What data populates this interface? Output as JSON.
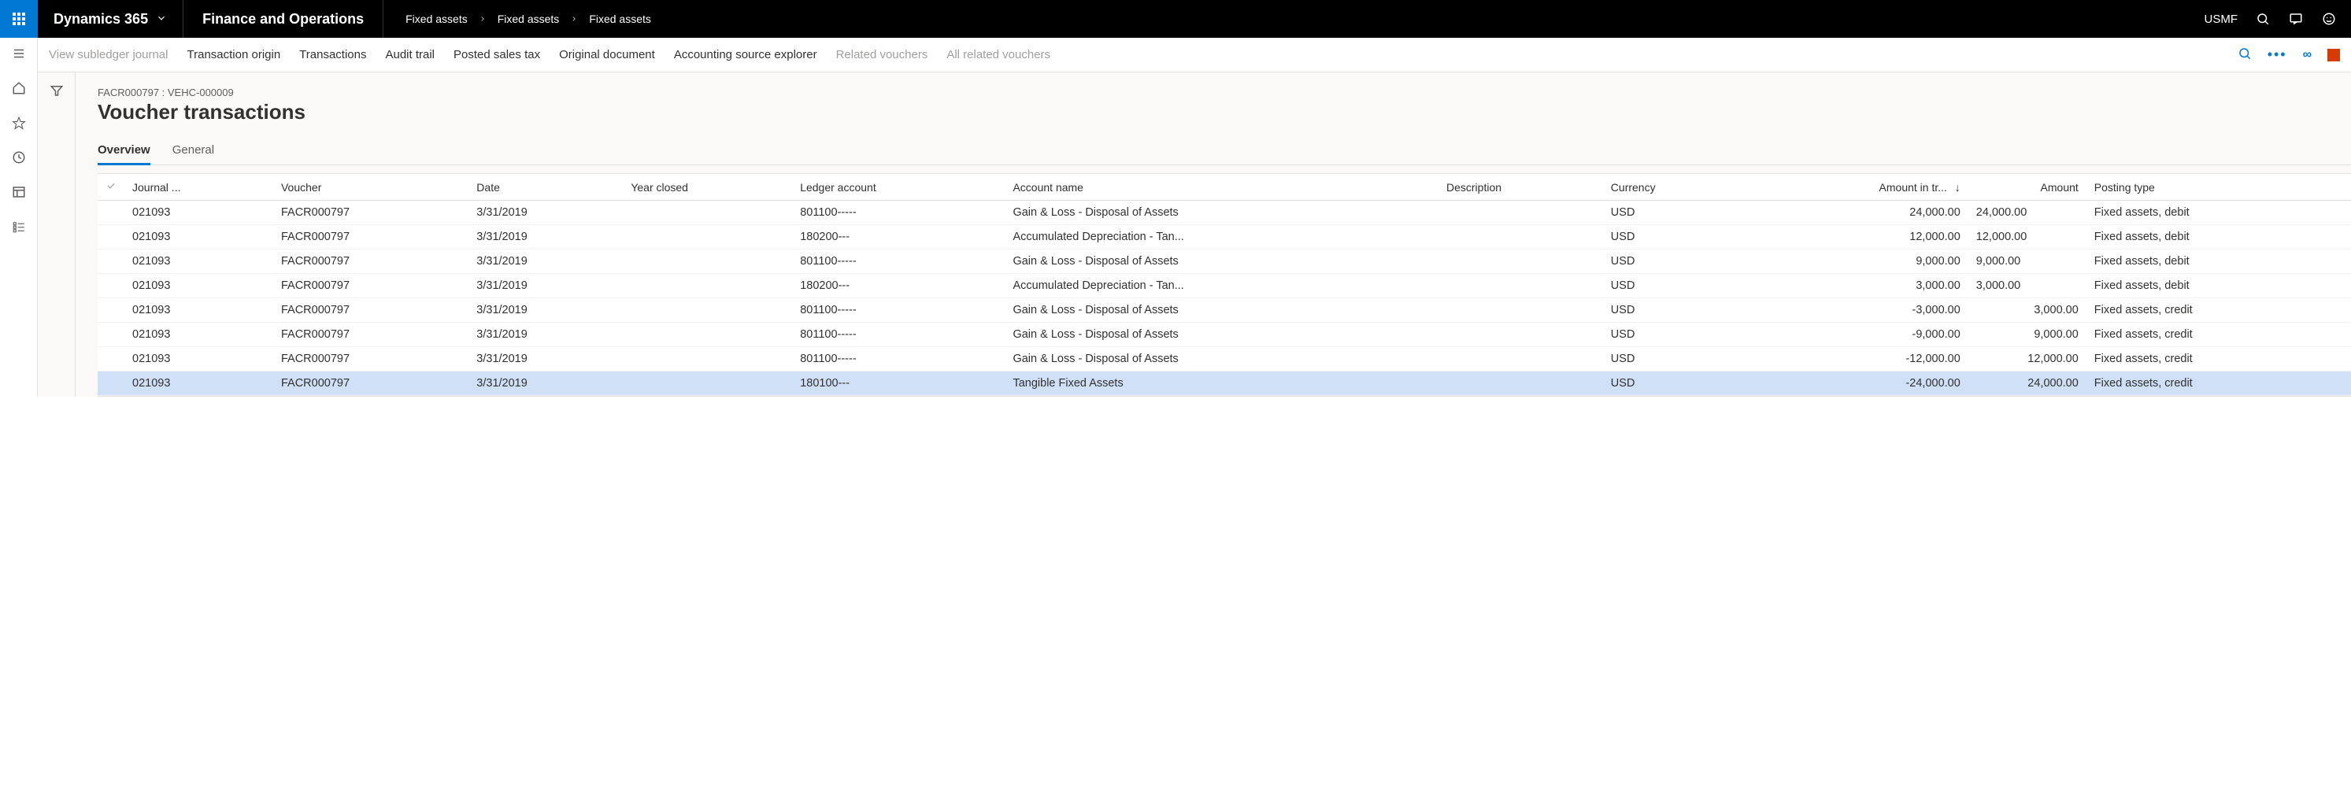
{
  "header": {
    "brand": "Dynamics 365",
    "module": "Finance and Operations",
    "breadcrumbs": [
      "Fixed assets",
      "Fixed assets",
      "Fixed assets"
    ],
    "company": "USMF"
  },
  "actions": {
    "view_subledger": "View subledger journal",
    "transaction_origin": "Transaction origin",
    "transactions": "Transactions",
    "audit_trail": "Audit trail",
    "posted_sales_tax": "Posted sales tax",
    "original_document": "Original document",
    "accounting_source_explorer": "Accounting source explorer",
    "related_vouchers": "Related vouchers",
    "all_related_vouchers": "All related vouchers"
  },
  "page": {
    "context": "FACR000797 : VEHC-000009",
    "title": "Voucher transactions",
    "tabs": {
      "overview": "Overview",
      "general": "General"
    }
  },
  "columns": {
    "journal": "Journal ...",
    "voucher": "Voucher",
    "date": "Date",
    "year_closed": "Year closed",
    "ledger_account": "Ledger account",
    "account_name": "Account name",
    "description": "Description",
    "currency": "Currency",
    "amount_in_trans": "Amount in tr...",
    "amount": "Amount",
    "posting_type": "Posting type"
  },
  "sort_indicator": "↓",
  "rows": [
    {
      "journal": "021093",
      "voucher": "FACR000797",
      "date": "3/31/2019",
      "year_closed": "",
      "ledger": "801100-----",
      "account": "Gain & Loss - Disposal of Assets",
      "desc": "",
      "cur": "USD",
      "amt_tr": "24,000.00",
      "amt": "24,000.00",
      "amt_align": "left",
      "ptype": "Fixed assets, debit",
      "selected": false
    },
    {
      "journal": "021093",
      "voucher": "FACR000797",
      "date": "3/31/2019",
      "year_closed": "",
      "ledger": "180200---",
      "account": "Accumulated Depreciation - Tan...",
      "desc": "",
      "cur": "USD",
      "amt_tr": "12,000.00",
      "amt": "12,000.00",
      "amt_align": "left",
      "ptype": "Fixed assets, debit",
      "selected": false
    },
    {
      "journal": "021093",
      "voucher": "FACR000797",
      "date": "3/31/2019",
      "year_closed": "",
      "ledger": "801100-----",
      "account": "Gain & Loss - Disposal of Assets",
      "desc": "",
      "cur": "USD",
      "amt_tr": "9,000.00",
      "amt": "9,000.00",
      "amt_align": "left",
      "ptype": "Fixed assets, debit",
      "selected": false
    },
    {
      "journal": "021093",
      "voucher": "FACR000797",
      "date": "3/31/2019",
      "year_closed": "",
      "ledger": "180200---",
      "account": "Accumulated Depreciation - Tan...",
      "desc": "",
      "cur": "USD",
      "amt_tr": "3,000.00",
      "amt": "3,000.00",
      "amt_align": "left",
      "ptype": "Fixed assets, debit",
      "selected": false
    },
    {
      "journal": "021093",
      "voucher": "FACR000797",
      "date": "3/31/2019",
      "year_closed": "",
      "ledger": "801100-----",
      "account": "Gain & Loss - Disposal of Assets",
      "desc": "",
      "cur": "USD",
      "amt_tr": "-3,000.00",
      "amt": "3,000.00",
      "amt_align": "right",
      "ptype": "Fixed assets, credit",
      "selected": false
    },
    {
      "journal": "021093",
      "voucher": "FACR000797",
      "date": "3/31/2019",
      "year_closed": "",
      "ledger": "801100-----",
      "account": "Gain & Loss - Disposal of Assets",
      "desc": "",
      "cur": "USD",
      "amt_tr": "-9,000.00",
      "amt": "9,000.00",
      "amt_align": "right",
      "ptype": "Fixed assets, credit",
      "selected": false
    },
    {
      "journal": "021093",
      "voucher": "FACR000797",
      "date": "3/31/2019",
      "year_closed": "",
      "ledger": "801100-----",
      "account": "Gain & Loss - Disposal of Assets",
      "desc": "",
      "cur": "USD",
      "amt_tr": "-12,000.00",
      "amt": "12,000.00",
      "amt_align": "right",
      "ptype": "Fixed assets, credit",
      "selected": false
    },
    {
      "journal": "021093",
      "voucher": "FACR000797",
      "date": "3/31/2019",
      "year_closed": "",
      "ledger": "180100---",
      "account": "Tangible Fixed Assets",
      "desc": "",
      "cur": "USD",
      "amt_tr": "-24,000.00",
      "amt": "24,000.00",
      "amt_align": "right",
      "ptype": "Fixed assets, credit",
      "selected": true
    }
  ]
}
